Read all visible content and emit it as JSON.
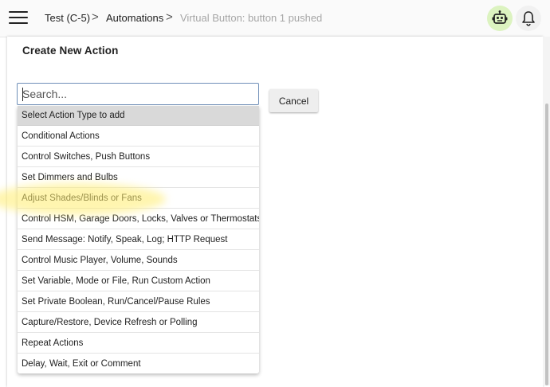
{
  "header": {
    "breadcrumbs": [
      "Test (C-5)",
      "Automations"
    ],
    "current_page": "Virtual Button: button 1 pushed",
    "separator": ">"
  },
  "card": {
    "title": "Create New Action"
  },
  "search": {
    "placeholder": "Search...",
    "value": ""
  },
  "cancel_label": "Cancel",
  "dropdown": {
    "header": "Select Action Type to add",
    "options": [
      "Conditional Actions",
      "Control Switches, Push Buttons",
      "Set Dimmers and Bulbs",
      "Adjust Shades/Blinds or Fans",
      "Control HSM, Garage Doors, Locks, Valves or Thermostats",
      "Send Message: Notify, Speak, Log; HTTP Request",
      "Control Music Player, Volume, Sounds",
      "Set Variable, Mode or File, Run Custom Action",
      "Set Private Boolean, Run/Cancel/Pause Rules",
      "Capture/Restore, Device Refresh or Polling",
      "Repeat Actions",
      "Delay, Wait, Exit or Comment"
    ]
  },
  "icons": {
    "menu": "hamburger-menu-icon",
    "robot": "robot-icon",
    "bell": "bell-icon"
  },
  "colors": {
    "robot_bg": "#dcf3c0",
    "list_header_bg": "#d9d9d9",
    "search_border": "#6f8fb8",
    "highlight": "#ffec6e"
  }
}
